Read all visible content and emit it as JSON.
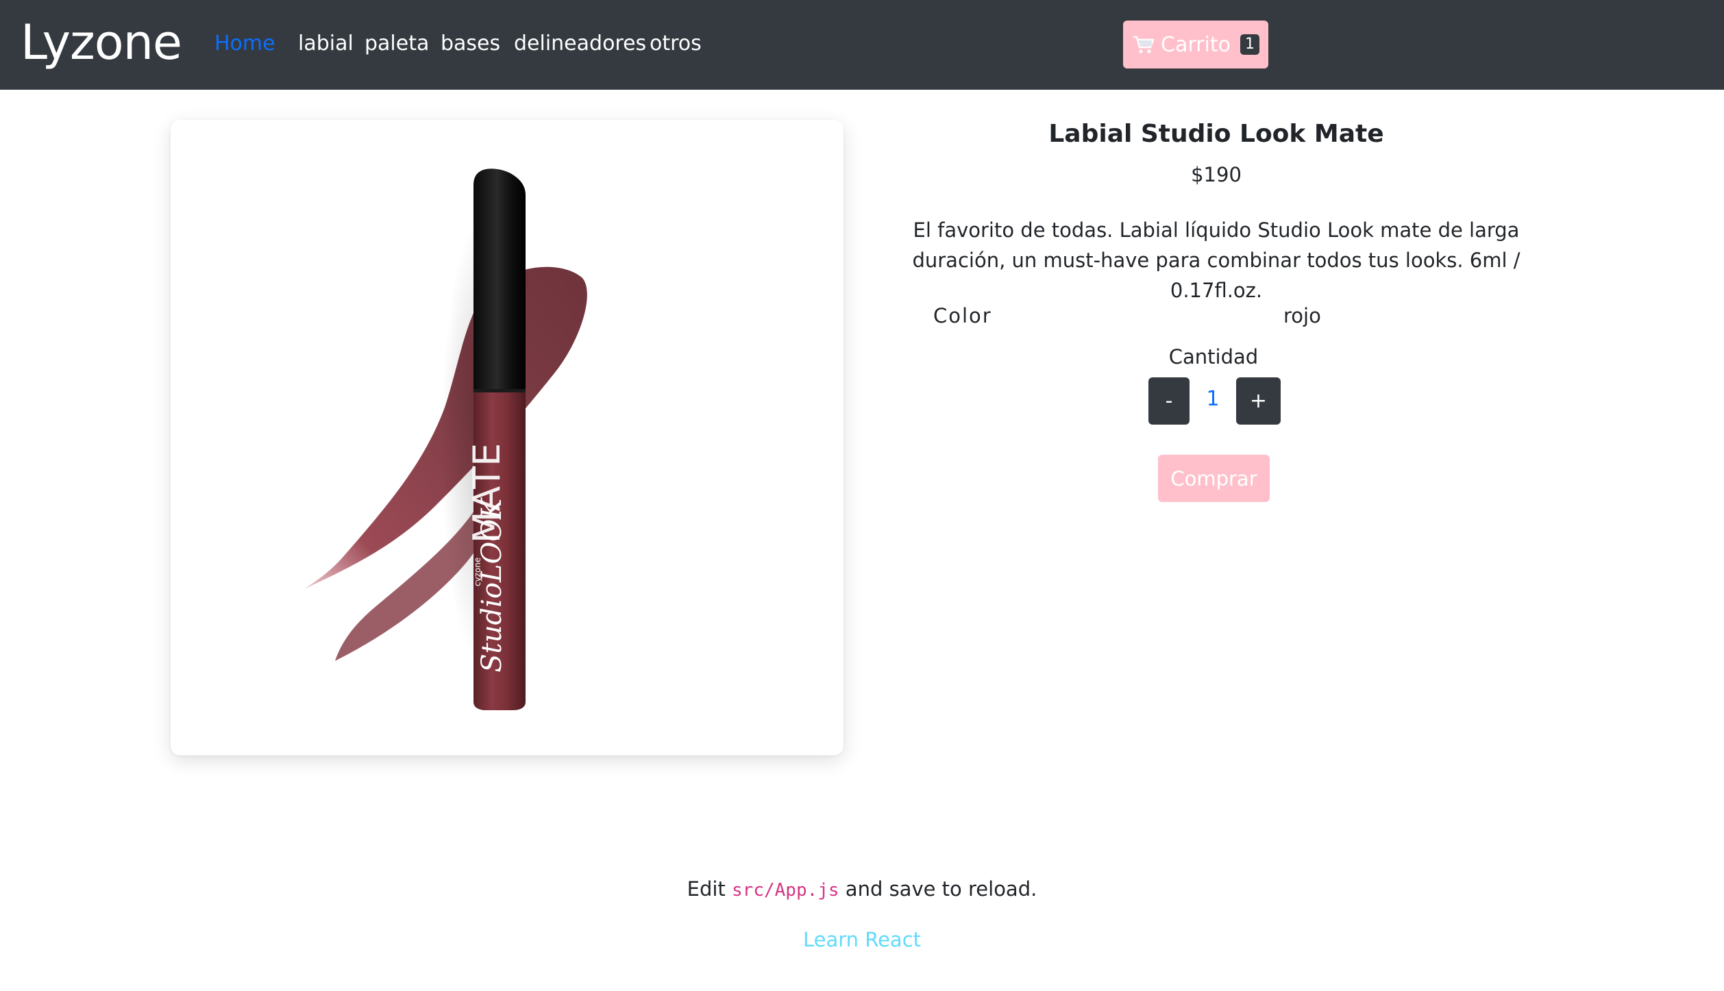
{
  "navbar": {
    "brand": "Lyzone",
    "links": [
      {
        "label": "Home",
        "active": true
      },
      {
        "label": "labial",
        "active": false
      },
      {
        "label": "paleta",
        "active": false
      },
      {
        "label": "bases",
        "active": false
      },
      {
        "label": "delineadores",
        "active": false
      },
      {
        "label": "otros",
        "active": false
      }
    ],
    "cart": {
      "label": "Carrito",
      "count": "1",
      "icon": "shopping-cart-icon"
    }
  },
  "product": {
    "title": "Labial Studio Look Mate",
    "price": "$190",
    "description": "El favorito de todas. Labial líquido Studio Look mate de larga duración, un must-have para combinar todos tus looks. 6ml / 0.17fl.oz.",
    "color_label": "Color",
    "color_value": "rojo",
    "quantity_label": "Cantidad",
    "quantity": "1",
    "minus_label": "-",
    "plus_label": "+",
    "buy_label": "Comprar",
    "image_text": {
      "tube_top": "MATE",
      "tube_brand": "StudioLOOK",
      "tube_maker": "cyzone"
    }
  },
  "footer": {
    "edit_prefix": "Edit",
    "edit_code": "src/App.js",
    "edit_suffix": "and save to reload.",
    "learn_link": "Learn React"
  },
  "colors": {
    "navbar_bg": "#343a40",
    "accent_pink": "#ffc0cb",
    "link_active": "#0d6efd",
    "react_link": "#61dafb",
    "code": "#d63384",
    "lipstick": "#7a3a40"
  }
}
